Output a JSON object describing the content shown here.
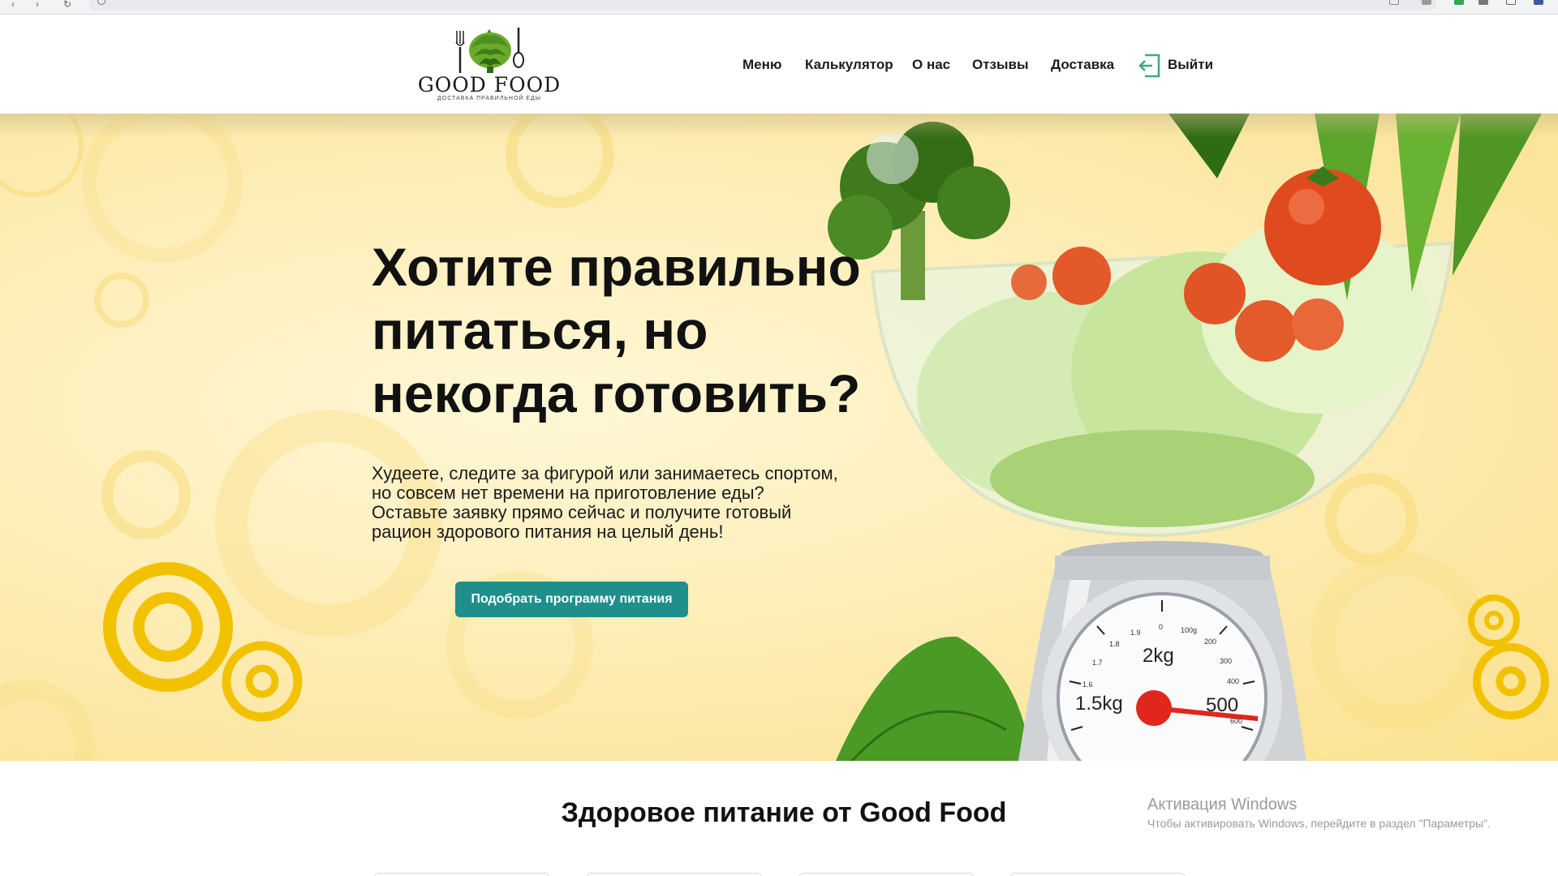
{
  "site": {
    "logo_text": "GOOD FOOD",
    "logo_tagline": "ДОСТАВКА ПРАВИЛЬНОЙ ЕДЫ"
  },
  "nav": {
    "items": [
      {
        "label": "Меню"
      },
      {
        "label": "Калькулятор"
      },
      {
        "label": "О нас"
      },
      {
        "label": "Отзывы"
      },
      {
        "label": "Доставка"
      }
    ],
    "logout_label": "Выйти"
  },
  "hero": {
    "title_lines": [
      "Хотите правильно",
      "питаться, но",
      "некогда готовить?"
    ],
    "text_lines": [
      "Худеете, следите за фигурой или занимаетесь спортом,",
      "но совсем нет времени на приготовление еды?",
      "Оставьте заявку прямо сейчас и получите готовый",
      "рацион здорового питания на целый день!"
    ],
    "cta_label": "Подобрать программу питания"
  },
  "scale_labels": {
    "big_1": "2kg",
    "big_2": "1.5kg",
    "big_3": "500",
    "small": [
      "0",
      "100g",
      "200",
      "300",
      "400",
      "600",
      "1.9",
      "1.8",
      "1.7",
      "1.6"
    ]
  },
  "section": {
    "title": "Здоровое питание от Good Food"
  },
  "windows_activation": {
    "title": "Активация Windows",
    "subtitle": "Чтобы активировать Windows, перейдите в раздел \"Параметры\"."
  },
  "colors": {
    "accent": "#1f8f8b",
    "hero_bg": "#fdebb0",
    "ring_yellow": "#f2c200",
    "logout_green": "#3daa7a"
  }
}
